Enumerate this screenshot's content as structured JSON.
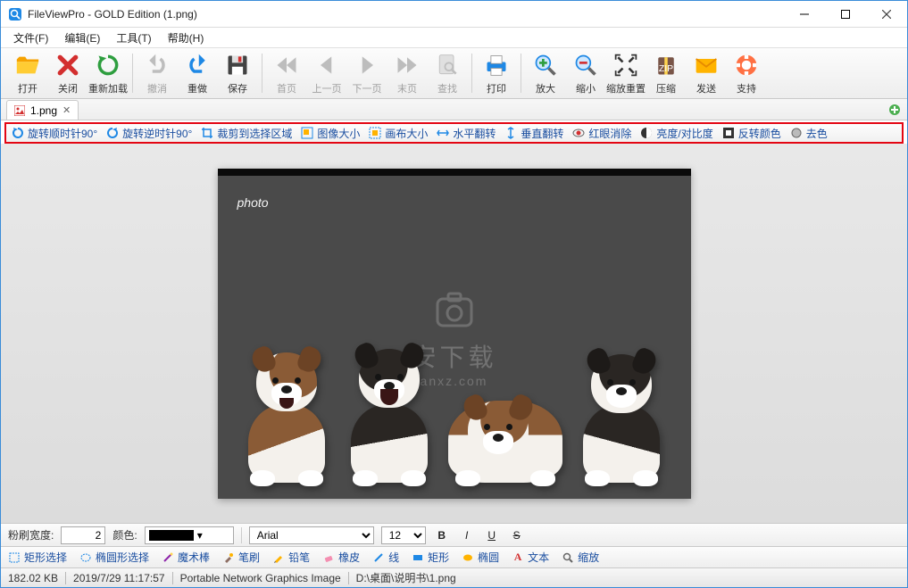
{
  "title": "FileViewPro - GOLD Edition (1.png)",
  "menus": {
    "file": "文件(F)",
    "edit": "编辑(E)",
    "tool": "工具(T)",
    "help": "帮助(H)"
  },
  "toolbar": {
    "open": "打开",
    "close": "关闭",
    "reload": "重新加载",
    "undo": "撤消",
    "redo": "重做",
    "save": "保存",
    "first": "首页",
    "prev": "上一页",
    "next": "下一页",
    "last": "末页",
    "find": "查找",
    "print": "打印",
    "zoomin": "放大",
    "zoomout": "缩小",
    "zoomreset": "缩放重置",
    "zip": "压缩",
    "send": "发送",
    "support": "支持"
  },
  "tab": {
    "name": "1.png"
  },
  "imgtools": {
    "rotcw": "旋转顺时针90°",
    "rotccw": "旋转逆时针90°",
    "crop": "裁剪到选择区域",
    "imgsize": "图像大小",
    "canvassize": "画布大小",
    "fliph": "水平翻转",
    "flipv": "垂直翻转",
    "redeye": "红眼消除",
    "brightness": "亮度/对比度",
    "invert": "反转颜色",
    "desaturate": "去色"
  },
  "watermark": {
    "line1": "安下载",
    "line2": "anxz.com"
  },
  "signature": "photo",
  "format": {
    "brushwidth_label": "粉刷宽度:",
    "brushwidth": "2",
    "color_label": "颜色:",
    "font": "Arial",
    "size": "12"
  },
  "tools": {
    "rectsel": "矩形选择",
    "ellipsesel": "椭圆形选择",
    "magicwand": "魔术棒",
    "brush": "笔刷",
    "pencil": "铅笔",
    "eraser": "橡皮",
    "line": "线",
    "rect": "矩形",
    "ellipse": "椭圆",
    "text": "文本",
    "zoom": "缩放"
  },
  "status": {
    "filesize": "182.02 KB",
    "datetime": "2019/7/29 11:17:57",
    "filetype": "Portable Network Graphics Image",
    "path": "D:\\桌面\\说明书\\1.png"
  }
}
